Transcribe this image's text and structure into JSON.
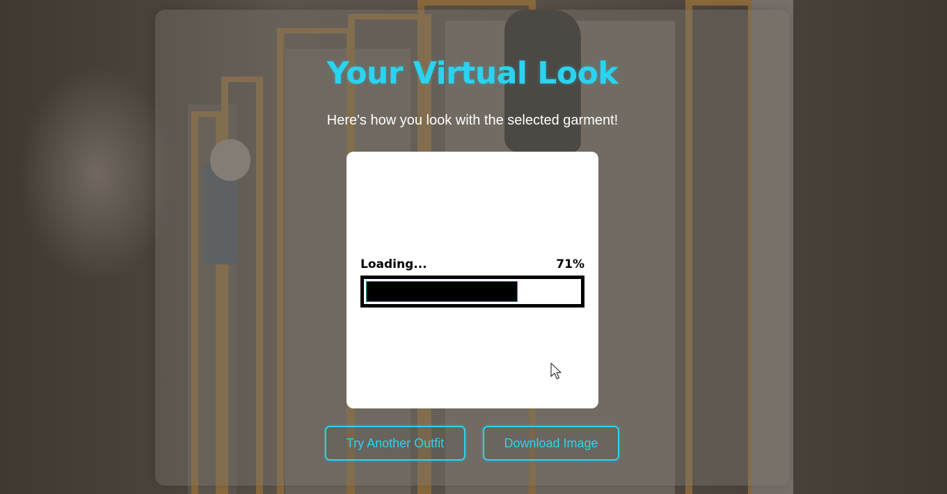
{
  "page": {
    "title": "Your Virtual Look",
    "subtitle": "Here's how you look with the selected garment!"
  },
  "result": {
    "loading_label": "Loading...",
    "progress_percent_label": "71%",
    "progress_value": 0.71
  },
  "actions": {
    "try_another_label": "Try Another Outfit",
    "download_label": "Download Image"
  },
  "colors": {
    "accent": "#2ad4f0",
    "progress_bar": "#000000",
    "panel_background": "#ffffff"
  },
  "icons": {
    "cursor": "mouse-pointer-icon"
  }
}
